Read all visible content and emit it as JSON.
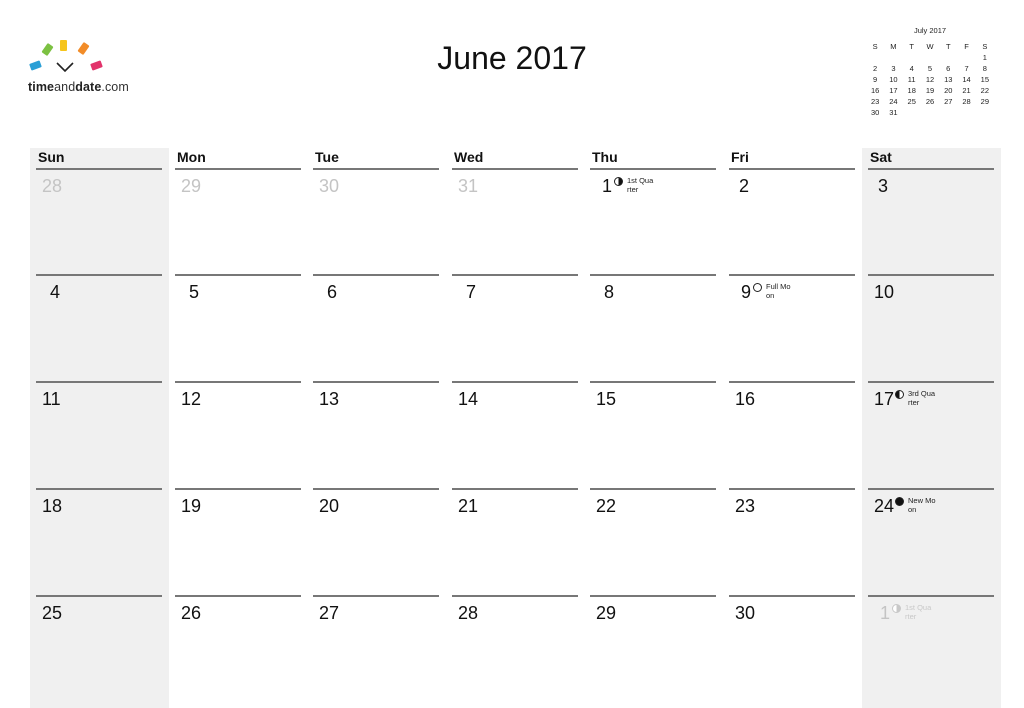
{
  "logo": {
    "brand_bold": "time",
    "brand_light": "and",
    "brand_bold2": "date",
    "brand_tld": ".com",
    "colors": [
      "#2a9fd6",
      "#7cc142",
      "#f6c51c",
      "#f28c28",
      "#e2336b"
    ]
  },
  "title": "June 2017",
  "mini_calendar": {
    "title": "July 2017",
    "weekdays": [
      "S",
      "M",
      "T",
      "W",
      "T",
      "F",
      "S"
    ],
    "weeks": [
      [
        "",
        "",
        "",
        "",
        "",
        "",
        "1"
      ],
      [
        "2",
        "3",
        "4",
        "5",
        "6",
        "7",
        "8"
      ],
      [
        "9",
        "10",
        "11",
        "12",
        "13",
        "14",
        "15"
      ],
      [
        "16",
        "17",
        "18",
        "19",
        "20",
        "21",
        "22"
      ],
      [
        "23",
        "24",
        "25",
        "26",
        "27",
        "28",
        "29"
      ],
      [
        "30",
        "31",
        "",
        "",
        "",
        "",
        ""
      ]
    ]
  },
  "calendar": {
    "weekdays": [
      "Sun",
      "Mon",
      "Tue",
      "Wed",
      "Thu",
      "Fri",
      "Sat"
    ],
    "weeks": [
      [
        {
          "d": "28",
          "out": true
        },
        {
          "d": "29",
          "out": true
        },
        {
          "d": "30",
          "out": true
        },
        {
          "d": "31",
          "out": true
        },
        {
          "d": "1",
          "moon": "first",
          "phase": "1st Quarter"
        },
        {
          "d": "2"
        },
        {
          "d": "3"
        }
      ],
      [
        {
          "d": "4"
        },
        {
          "d": "5"
        },
        {
          "d": "6"
        },
        {
          "d": "7"
        },
        {
          "d": "8"
        },
        {
          "d": "9",
          "moon": "full",
          "phase": "Full Moon"
        },
        {
          "d": "10"
        }
      ],
      [
        {
          "d": "11"
        },
        {
          "d": "12"
        },
        {
          "d": "13"
        },
        {
          "d": "14"
        },
        {
          "d": "15"
        },
        {
          "d": "16"
        },
        {
          "d": "17",
          "moon": "third",
          "phase": "3rd Quarter"
        }
      ],
      [
        {
          "d": "18"
        },
        {
          "d": "19"
        },
        {
          "d": "20"
        },
        {
          "d": "21"
        },
        {
          "d": "22"
        },
        {
          "d": "23"
        },
        {
          "d": "24",
          "moon": "new",
          "phase": "New Moon"
        }
      ],
      [
        {
          "d": "25"
        },
        {
          "d": "26"
        },
        {
          "d": "27"
        },
        {
          "d": "28"
        },
        {
          "d": "29"
        },
        {
          "d": "30"
        },
        {
          "d": "1",
          "out": true,
          "moon": "first",
          "phase": "1st Quarter"
        }
      ]
    ]
  }
}
